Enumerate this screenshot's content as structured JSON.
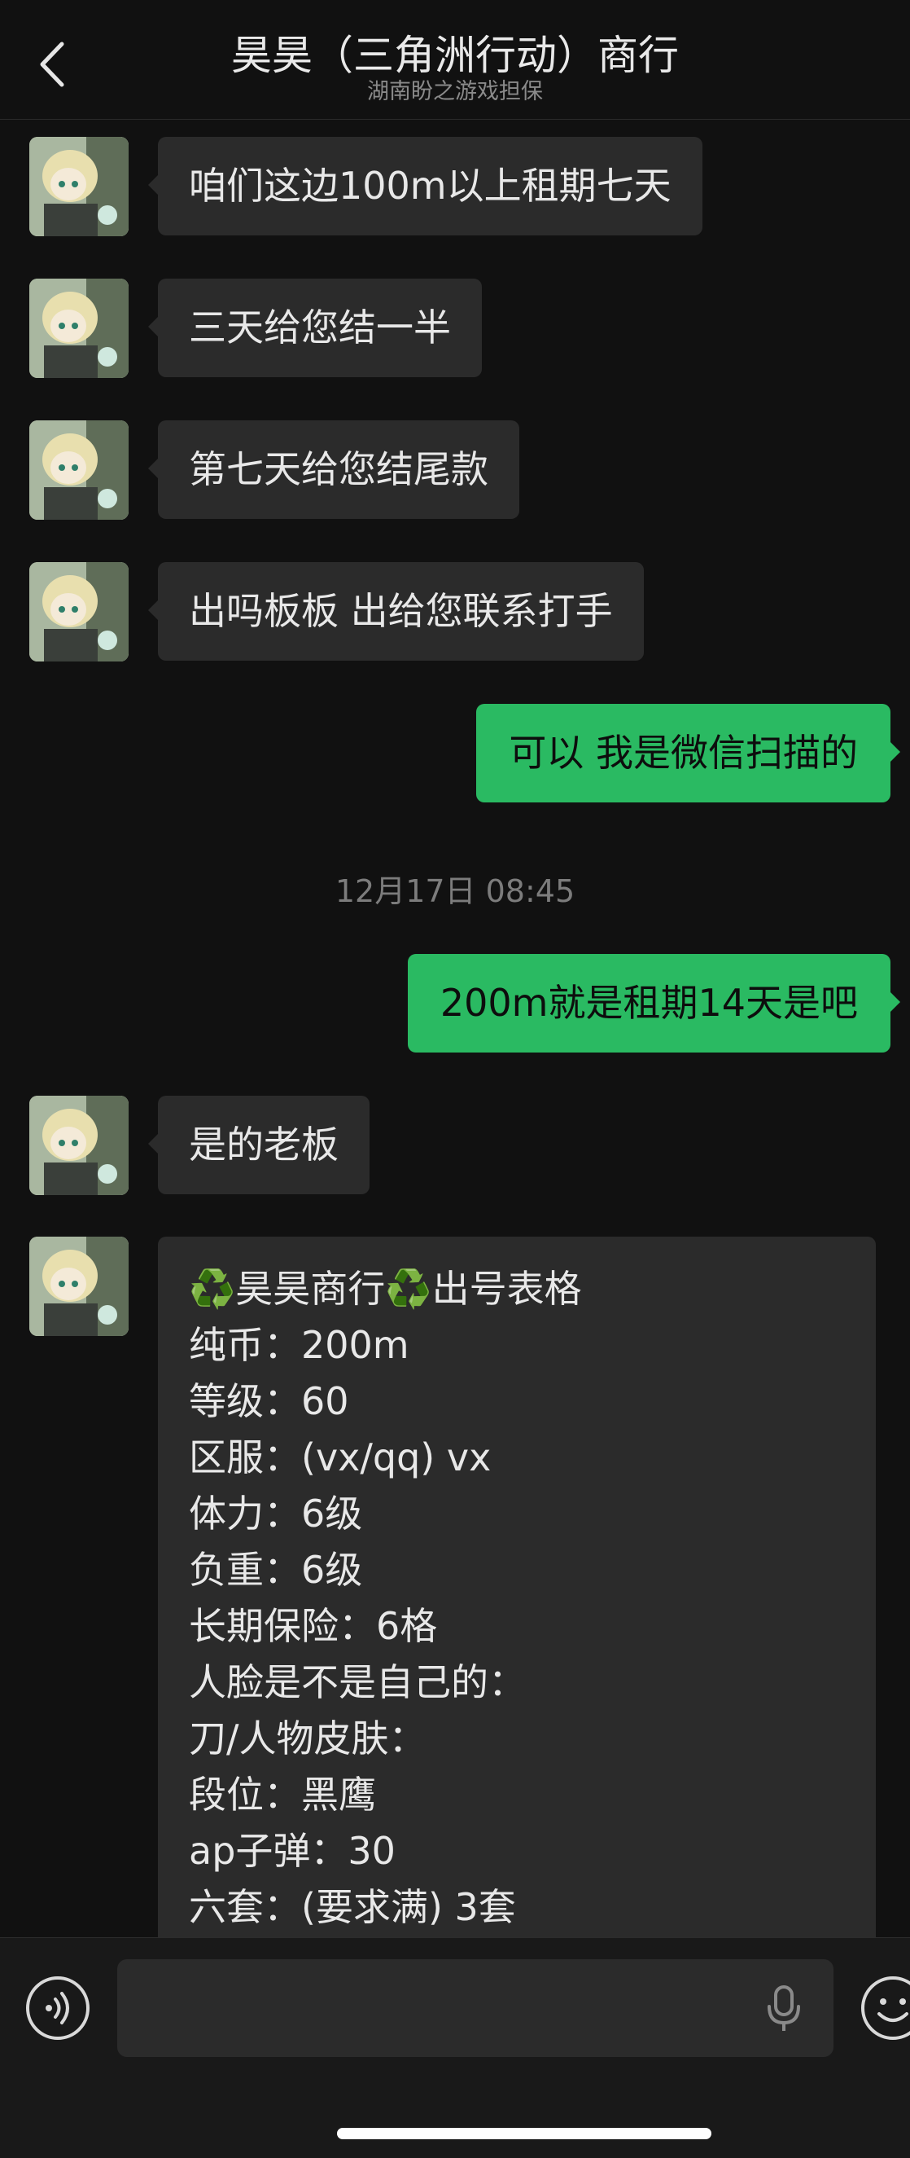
{
  "header": {
    "title": "昊昊（三角洲行动）商行",
    "subtitle": "湖南盼之游戏担保"
  },
  "messages": [
    {
      "direction": "in",
      "text": "咱们这边100m以上租期七天"
    },
    {
      "direction": "in",
      "text": "三天给您结一半"
    },
    {
      "direction": "in",
      "text": "第七天给您结尾款"
    },
    {
      "direction": "in",
      "text": "出吗板板 出给您联系打手"
    },
    {
      "direction": "out",
      "text": "可以 我是微信扫描的"
    },
    {
      "direction": "out",
      "text": "200m就是租期14天是吧"
    },
    {
      "direction": "in",
      "text": "是的老板"
    }
  ],
  "timestamp": "12月17日 08:45",
  "form_message": {
    "title_emoji": "♻️",
    "title_text": "昊昊商行",
    "title_text_2": "出号表格",
    "lines": [
      "纯币：200m",
      "等级：60",
      "区服：(vx/qq) vx",
      "体力：6级",
      "负重：6级",
      "长期保险：6格",
      "人脸是不是自己的：",
      "刀/人物皮肤：",
      "段位：黑鹰",
      "ap子弹：30",
      "六套：(要求满) 3套"
    ]
  },
  "input": {
    "value": ""
  },
  "icons": {
    "back": "chevron-left-icon",
    "voice": "voice-icon",
    "mic": "microphone-icon",
    "emoji": "emoji-icon",
    "avatar": "anime-avatar"
  },
  "colors": {
    "background": "#111111",
    "incoming_bubble": "#2b2b2b",
    "outgoing_bubble": "#2aba62",
    "timestamp": "#7c7c7c"
  }
}
